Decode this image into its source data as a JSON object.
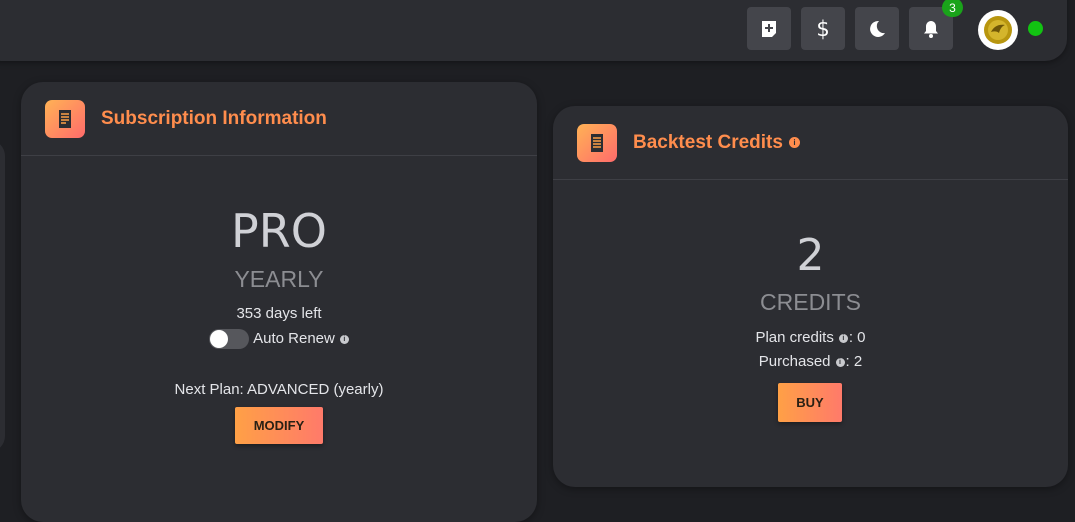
{
  "topbar": {
    "notification_count": "3",
    "icons": [
      "add-note-icon",
      "dollar-icon",
      "moon-icon",
      "bell-icon"
    ],
    "status_color": "#12c312"
  },
  "subscription": {
    "title": "Subscription Information",
    "plan": "PRO",
    "period": "YEARLY",
    "days_left": "353 days left",
    "auto_renew_label": "Auto Renew",
    "auto_renew_enabled": false,
    "next_plan": "Next Plan: ADVANCED (yearly)",
    "modify_label": "MODIFY"
  },
  "credits": {
    "title": "Backtest Credits",
    "count": "2",
    "unit": "CREDITS",
    "plan_credits_label": "Plan credits",
    "plan_credits_value": ": 0",
    "purchased_label": "Purchased",
    "purchased_value": ": 2",
    "buy_label": "BUY"
  },
  "colors": {
    "accent": "#ff8d4d",
    "card_bg": "#2c2d32",
    "page_bg": "#1e1f23",
    "badge": "#1aa31a"
  }
}
